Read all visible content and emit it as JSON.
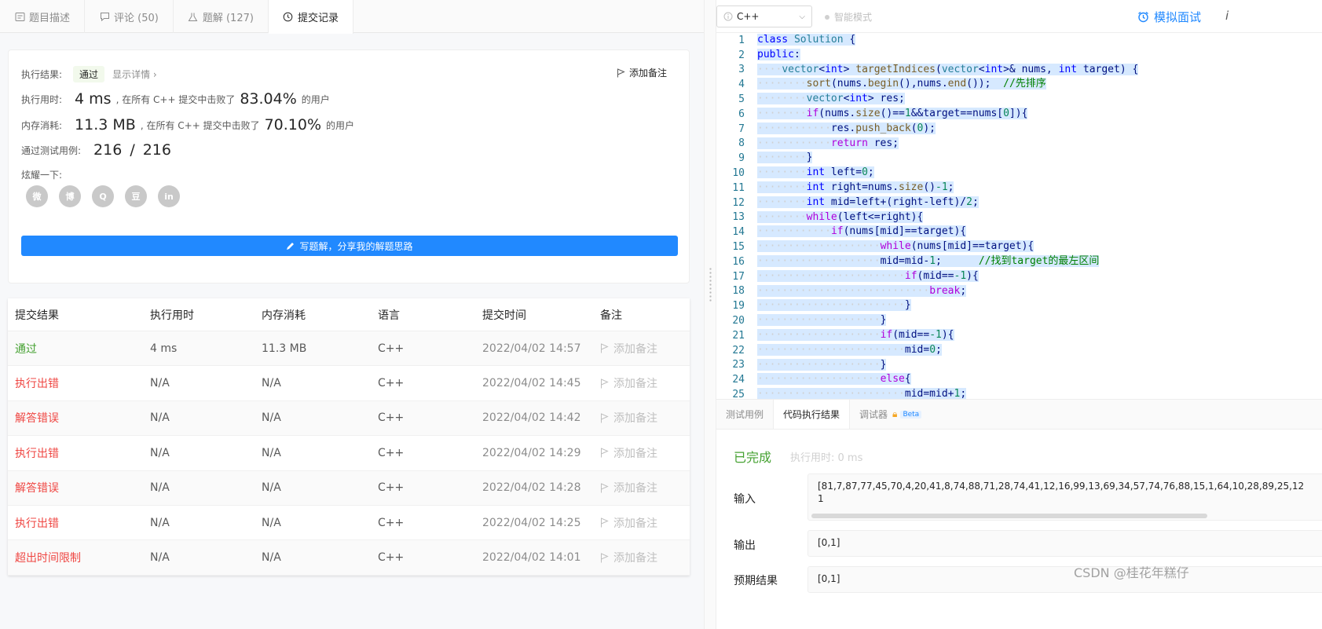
{
  "tabs": [
    {
      "label": "题目描述",
      "icon": "description-icon"
    },
    {
      "label": "评论 (50)",
      "icon": "comment-icon"
    },
    {
      "label": "题解 (127)",
      "icon": "flask-icon"
    },
    {
      "label": "提交记录",
      "icon": "clock-icon",
      "active": true
    }
  ],
  "result": {
    "status_label": "执行结果:",
    "status_value": "通过",
    "detail_link": "显示详情 ›",
    "add_note": "添加备注",
    "time_label": "执行用时:",
    "time_value": "4 ms",
    "time_text": ", 在所有 C++ 提交中击败了",
    "time_percent": "83.04%",
    "users_text": "的用户",
    "mem_label": "内存消耗:",
    "mem_value": "11.3 MB",
    "mem_text": ", 在所有 C++ 提交中击败了",
    "mem_percent": "70.10%",
    "cases_label": "通过测试用例:",
    "cases_passed": "216",
    "cases_sep": "/",
    "cases_total": "216",
    "share_label": "炫耀一下:",
    "share_icons": [
      "wechat-icon",
      "weibo-icon",
      "qq-icon",
      "douban-icon",
      "linkedin-icon"
    ],
    "share_glyphs": [
      "微",
      "博",
      "Q",
      "豆",
      "in"
    ],
    "write_button": "写题解，分享我的解题思路"
  },
  "table": {
    "headers": [
      "提交结果",
      "执行用时",
      "内存消耗",
      "语言",
      "提交时间",
      "备注"
    ],
    "rows": [
      {
        "result": "通过",
        "kind": "ok",
        "time": "4 ms",
        "memory": "11.3 MB",
        "lang": "C++",
        "submitted": "2022/04/02 14:57",
        "note": "添加备注"
      },
      {
        "result": "执行出错",
        "kind": "err",
        "time": "N/A",
        "memory": "N/A",
        "lang": "C++",
        "submitted": "2022/04/02 14:45",
        "note": "添加备注"
      },
      {
        "result": "解答错误",
        "kind": "err",
        "time": "N/A",
        "memory": "N/A",
        "lang": "C++",
        "submitted": "2022/04/02 14:42",
        "note": "添加备注"
      },
      {
        "result": "执行出错",
        "kind": "err",
        "time": "N/A",
        "memory": "N/A",
        "lang": "C++",
        "submitted": "2022/04/02 14:29",
        "note": "添加备注"
      },
      {
        "result": "解答错误",
        "kind": "err",
        "time": "N/A",
        "memory": "N/A",
        "lang": "C++",
        "submitted": "2022/04/02 14:28",
        "note": "添加备注"
      },
      {
        "result": "执行出错",
        "kind": "err",
        "time": "N/A",
        "memory": "N/A",
        "lang": "C++",
        "submitted": "2022/04/02 14:25",
        "note": "添加备注"
      },
      {
        "result": "超出时间限制",
        "kind": "err",
        "time": "N/A",
        "memory": "N/A",
        "lang": "C++",
        "submitted": "2022/04/02 14:01",
        "note": "添加备注"
      }
    ]
  },
  "editor": {
    "language": "C++",
    "smart_mode": "智能模式",
    "mock_interview": "模拟面试",
    "info": "i",
    "lines": [
      "class Solution {",
      "public:",
      "    vector<int> targetIndices(vector<int>& nums, int target) {",
      "        sort(nums.begin(),nums.end());  //先排序",
      "        vector<int> res;",
      "        if(nums.size()==1&&target==nums[0]){",
      "            res.push_back(0);",
      "            return res;",
      "        }",
      "        int left=0;",
      "        int right=nums.size()-1;",
      "        int mid=left+(right-left)/2;",
      "        while(left<=right){",
      "            if(nums[mid]==target){",
      "                    while(nums[mid]==target){",
      "                    mid=mid-1;      //找到target的最左区间",
      "                        if(mid==-1){",
      "                            break;",
      "                        }",
      "                    }",
      "                    if(mid==-1){",
      "                        mid=0;",
      "                    }",
      "                    else{",
      "                        mid=mid+1;"
    ]
  },
  "console": {
    "tabs": [
      "测试用例",
      "代码执行结果",
      "调试器"
    ],
    "beta": "Beta",
    "status": "已完成",
    "exec_time": "执行用时: 0 ms",
    "input_label": "输入",
    "input_value_line1": "[81,7,87,77,45,70,4,20,41,8,74,88,71,28,74,41,12,16,99,13,69,34,57,74,76,88,15,1,64,10,28,89,25,12",
    "input_value_line2": "1",
    "output_label": "输出",
    "output_value": "[0,1]",
    "expected_label": "预期结果",
    "expected_value": "[0,1]"
  },
  "watermark": "CSDN @桂花年糕仔",
  "colors": {
    "accent": "#2189ff",
    "success": "#45a131",
    "error": "#ef4743"
  }
}
